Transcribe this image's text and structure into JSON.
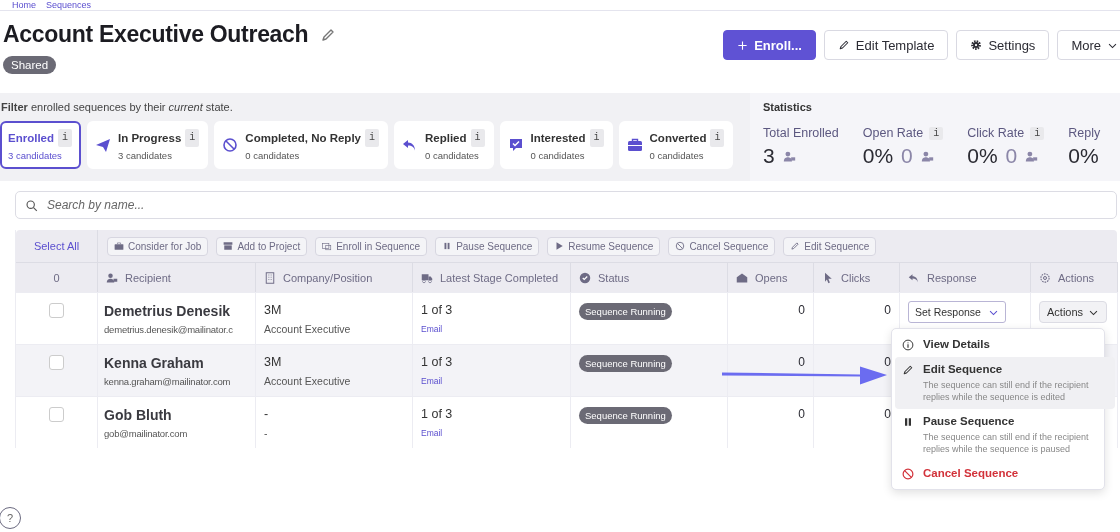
{
  "breadcrumb": [
    "Home",
    "Sequences"
  ],
  "title": "Account Executive Outreach",
  "badge": "Shared",
  "header_buttons": [
    {
      "label": "Enroll...",
      "kind": "primary"
    },
    {
      "label": "Edit Template",
      "kind": "edit"
    },
    {
      "label": "Settings",
      "kind": "settings"
    },
    {
      "label": "More",
      "kind": "more"
    }
  ],
  "filter_hint": "**Filter** enrolled sequences by their *current* state.",
  "filters": [
    {
      "label": "Enrolled",
      "count": "3 candidates",
      "info": "i",
      "selected": true
    },
    {
      "label": "In Progress",
      "count": "3 candidates",
      "info": "i",
      "selected": false
    },
    {
      "label": "Completed, No Reply",
      "count": "0 candidates",
      "info": "i",
      "selected": false
    },
    {
      "label": "Replied",
      "count": "0 candidates",
      "info": "i",
      "selected": false
    },
    {
      "label": "Interested",
      "count": "0 candidates",
      "info": "i",
      "selected": false
    },
    {
      "label": "Converted",
      "count": "0 candidates",
      "info": "i",
      "selected": false
    }
  ],
  "statistics": {
    "title": "Statistics",
    "items": [
      {
        "label": "Total Enrolled",
        "value": "3"
      },
      {
        "label": "Open Rate",
        "info": "i",
        "value": "0%",
        "count": "0"
      },
      {
        "label": "Click Rate",
        "info": "i",
        "value": "0%",
        "count": "0"
      },
      {
        "label": "Reply",
        "value": "0%"
      }
    ]
  },
  "search": {
    "placeholder": "Search by name..."
  },
  "table": {
    "select_all": "Select All",
    "bulk_actions": [
      {
        "label": "Consider for Job",
        "disabled": true
      },
      {
        "label": "Add to Project",
        "disabled": true
      },
      {
        "label": "Enroll in Sequence",
        "disabled": true
      },
      {
        "label": "Pause Sequence",
        "disabled": true
      },
      {
        "label": "Resume Sequence",
        "disabled": true
      },
      {
        "label": "Cancel Sequence",
        "disabled": true
      },
      {
        "label": "Edit Sequence",
        "disabled": true
      }
    ],
    "selected_count": "0",
    "columns": [
      "Recipient",
      "Company/Position",
      "Latest Stage Completed",
      "Status",
      "Opens",
      "Clicks",
      "Response",
      "Actions"
    ],
    "rows": [
      {
        "checked": false,
        "hovered": false,
        "name": "Demetrius Denesik",
        "email": "demetrius.denesik@mailinator.c",
        "company": "3M",
        "position": "Account Executive",
        "stage": "1 of 3",
        "stage_type": "Email",
        "status": "Sequence Running",
        "opens": "0",
        "clicks": "0",
        "response": "Set Response",
        "actions": "Actions"
      },
      {
        "checked": false,
        "hovered": true,
        "name": "Kenna Graham",
        "email": "kenna.graham@mailinator.com",
        "company": "3M",
        "position": "Account Executive",
        "stage": "1 of 3",
        "stage_type": "Email",
        "status": "Sequence Running",
        "opens": "0",
        "clicks": "0"
      },
      {
        "checked": false,
        "hovered": false,
        "name": "Gob Bluth",
        "email": "gob@mailinator.com",
        "company": "-",
        "position": "-",
        "stage": "1 of 3",
        "stage_type": "Email",
        "status": "Sequence Running",
        "opens": "0",
        "clicks": "0"
      }
    ]
  },
  "actions_menu": [
    {
      "kind": "plain",
      "label": "View Details",
      "selected": false
    },
    {
      "kind": "described",
      "label": "Edit Sequence",
      "description": "The sequence can still end if the recipient replies while the sequence is edited",
      "selected": true
    },
    {
      "kind": "described",
      "label": "Pause Sequence",
      "description": "The sequence can still end if the recipient replies while the sequence is paused",
      "selected": false
    },
    {
      "kind": "danger",
      "label": "Cancel Sequence",
      "selected": false
    }
  ],
  "help": "?"
}
